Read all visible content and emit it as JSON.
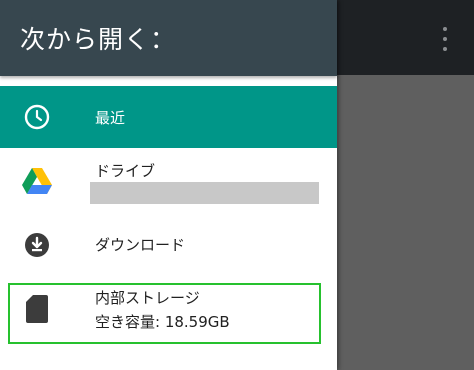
{
  "drawer": {
    "title": "次から開く：",
    "items": [
      {
        "label": "最近",
        "icon": "clock-icon",
        "selected": true
      },
      {
        "label": "ドライブ",
        "icon": "google-drive-icon"
      },
      {
        "label": "ダウンロード",
        "icon": "download-icon"
      },
      {
        "label": "内部ストレージ",
        "sublabel": "空き容量: 18.59GB",
        "icon": "sd-card-icon"
      }
    ]
  },
  "colors": {
    "header": "#37474f",
    "selected": "#009688",
    "highlight": "#26c12e",
    "background_dim": "#5f5f5f",
    "appbar_dim": "#1e2124"
  }
}
